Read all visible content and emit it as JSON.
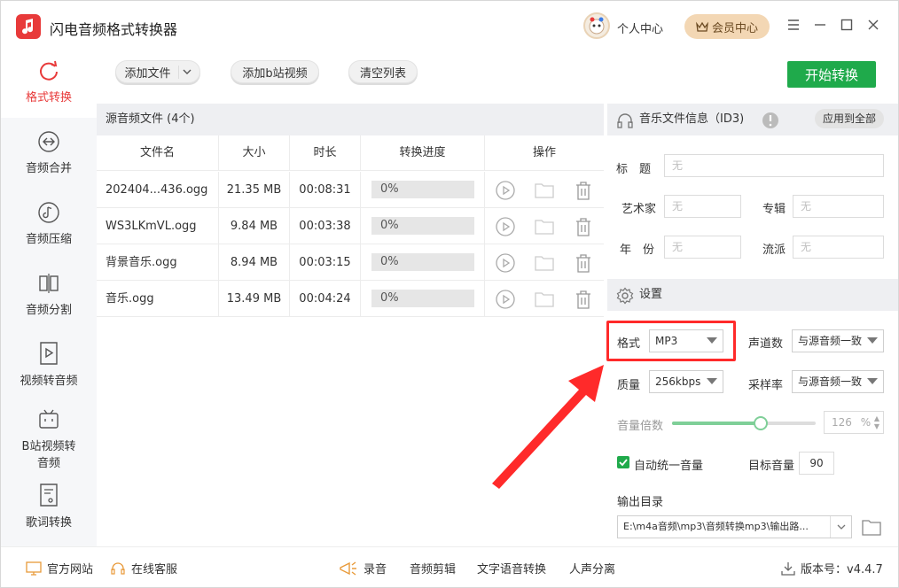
{
  "app": {
    "title": "闪电音频格式转换器",
    "accent": "#e83a3a"
  },
  "header": {
    "personal_center": "个人中心",
    "vip_center": "会员中心"
  },
  "sidebar": {
    "items": [
      {
        "label": "格式转换",
        "icon": "refresh-circle-icon",
        "active": true
      },
      {
        "label": "音频合并",
        "icon": "merge-icon"
      },
      {
        "label": "音频压缩",
        "icon": "music-note-icon"
      },
      {
        "label": "音频分割",
        "icon": "split-icon"
      },
      {
        "label": "视频转音频",
        "icon": "video-play-icon"
      },
      {
        "label": "B站视频转",
        "label2": "音频",
        "icon": "bilibili-icon"
      },
      {
        "label": "歌词转换",
        "icon": "lyrics-icon"
      }
    ]
  },
  "toolbar": {
    "add_file": "添加文件",
    "add_bilibili": "添加b站视频",
    "clear_list": "清空列表",
    "start": "开始转换",
    "start_color": "#1faa4b"
  },
  "files": {
    "header": "源音频文件 (4个)",
    "columns": [
      "文件名",
      "大小",
      "时长",
      "转换进度",
      "操作"
    ],
    "rows": [
      {
        "name": "202404...436.ogg",
        "size": "21.35 MB",
        "duration": "00:08:31",
        "progress": "0%"
      },
      {
        "name": "WS3LKmVL.ogg",
        "size": "9.84 MB",
        "duration": "00:03:38",
        "progress": "0%"
      },
      {
        "name": "背景音乐.ogg",
        "size": "8.94 MB",
        "duration": "00:03:15",
        "progress": "0%"
      },
      {
        "name": "音乐.ogg",
        "size": "13.49 MB",
        "duration": "00:04:24",
        "progress": "0%"
      }
    ]
  },
  "id3": {
    "title": "音乐文件信息（ID3)",
    "apply_all": "应用到全部",
    "title_label": "标　题",
    "artist_label": "艺术家",
    "album_label": "专辑",
    "year_label": "年　份",
    "genre_label": "流派",
    "placeholder": "无"
  },
  "settings": {
    "title": "设置",
    "format_label": "格式",
    "format_value": "MP3",
    "channel_label": "声道数",
    "channel_value": "与源音频一致",
    "quality_label": "质量",
    "quality_value": "256kbps",
    "samplerate_label": "采样率",
    "samplerate_value": "与源音频一致",
    "volume_label": "音量倍数",
    "volume_value": "126",
    "volume_unit": "%",
    "auto_volume_label": "自动统一音量",
    "auto_volume_checked": true,
    "target_volume_label": "目标音量",
    "target_volume_value": "90",
    "output_label": "输出目录",
    "output_path": "E:\\m4a音频\\mp3\\音频转换mp3\\输出路..."
  },
  "annotation": {
    "highlight_color": "#ff2a2a"
  },
  "footer": {
    "website": "官方网站",
    "service": "在线客服",
    "record": "录音",
    "edit": "音频剪辑",
    "tts": "文字语音转换",
    "vocal": "人声分离",
    "version": "版本号：v4.4.7"
  }
}
